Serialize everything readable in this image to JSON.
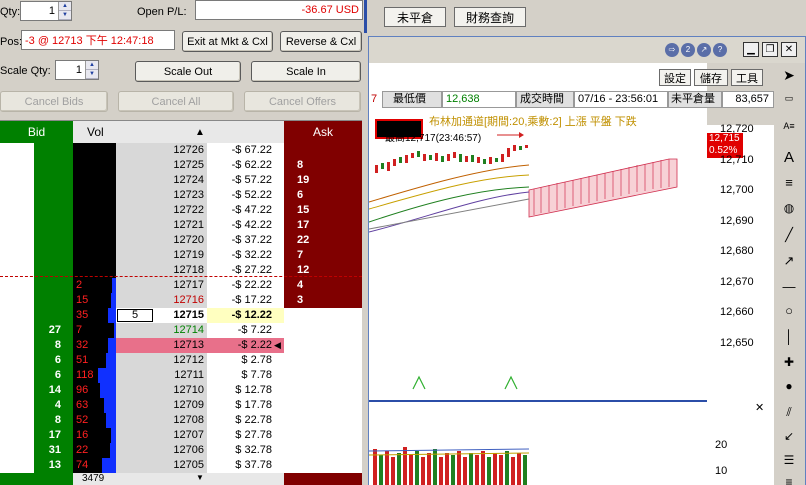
{
  "order_panel": {
    "qty_label": "Qty:",
    "qty_value": "1",
    "open_pl_label": "Open P/L:",
    "open_pl_value": "-36.67 USD",
    "pos_label": "Pos:",
    "pos_value": "-3 @ 12713 下午 12:47:18",
    "close_mkt_button": "Exit at Mkt & Cxl",
    "reverse_button": "Reverse & Cxl",
    "scale_qty_label": "Scale Qty:",
    "scale_qty_value": "1",
    "scale_out_button": "Scale Out",
    "scale_in_button": "Scale In",
    "cancel_bids_button": "Cancel Bids",
    "cancel_all_button": "Cancel All",
    "cancel_offers_button": "Cancel Offers"
  },
  "ladder": {
    "headers": {
      "bid": "Bid",
      "vol": "Vol",
      "ask": "Ask",
      "up_arrow": "▲",
      "down_arrow": "▼"
    },
    "rows": [
      {
        "bid": "",
        "vol": "",
        "price": "12726",
        "pl": "-$ 67.22",
        "ask": ""
      },
      {
        "bid": "",
        "vol": "",
        "price": "12725",
        "pl": "-$ 62.22",
        "ask": "8"
      },
      {
        "bid": "",
        "vol": "",
        "price": "12724",
        "pl": "-$ 57.22",
        "ask": "19"
      },
      {
        "bid": "",
        "vol": "",
        "price": "12723",
        "pl": "-$ 52.22",
        "ask": "6"
      },
      {
        "bid": "",
        "vol": "",
        "price": "12722",
        "pl": "-$ 47.22",
        "ask": "15"
      },
      {
        "bid": "",
        "vol": "",
        "price": "12721",
        "pl": "-$ 42.22",
        "ask": "17"
      },
      {
        "bid": "",
        "vol": "",
        "price": "12720",
        "pl": "-$ 37.22",
        "ask": "22"
      },
      {
        "bid": "",
        "vol": "",
        "price": "12719",
        "pl": "-$ 32.22",
        "ask": "7"
      },
      {
        "bid": "",
        "vol": "",
        "price": "12718",
        "pl": "-$ 27.22",
        "ask": "12"
      },
      {
        "bid": "",
        "vol": "2",
        "price": "12717",
        "pl": "-$ 22.22",
        "ask": "4"
      },
      {
        "bid": "",
        "vol": "15",
        "price": "12716",
        "pl": "-$ 17.22",
        "ask": "3"
      },
      {
        "bid": "",
        "vol": "35",
        "price": "12715",
        "pl": "-$ 12.22",
        "ask": ""
      },
      {
        "bid": "27",
        "vol": "7",
        "price": "12714",
        "pl": "-$ 7.22",
        "ask": ""
      },
      {
        "bid": "8",
        "vol": "32",
        "price": "12713",
        "pl": "-$ 2.22",
        "ask": ""
      },
      {
        "bid": "6",
        "vol": "51",
        "price": "12712",
        "pl": "$ 2.78",
        "ask": ""
      },
      {
        "bid": "6",
        "vol": "118",
        "price": "12711",
        "pl": "$ 7.78",
        "ask": ""
      },
      {
        "bid": "14",
        "vol": "96",
        "price": "12710",
        "pl": "$ 12.78",
        "ask": ""
      },
      {
        "bid": "4",
        "vol": "63",
        "price": "12709",
        "pl": "$ 17.78",
        "ask": ""
      },
      {
        "bid": "8",
        "vol": "52",
        "price": "12708",
        "pl": "$ 22.78",
        "ask": ""
      },
      {
        "bid": "17",
        "vol": "16",
        "price": "12707",
        "pl": "$ 27.78",
        "ask": ""
      },
      {
        "bid": "31",
        "vol": "22",
        "price": "12706",
        "pl": "$ 32.78",
        "ask": ""
      },
      {
        "bid": "13",
        "vol": "74",
        "price": "12705",
        "pl": "$ 37.78",
        "ask": ""
      }
    ],
    "order_qty": "5",
    "total_vol": "3479"
  },
  "toolbar_right": {
    "unclosed_button": "未平倉",
    "finance_button": "財務查詢"
  },
  "chart_window": {
    "settings_button": "設定",
    "save_button": "儲存",
    "tools_button": "工具",
    "low_label": "最低價",
    "low_value": "12,638",
    "time_label": "成交時間",
    "time_value": "07/16 - 23:56:01",
    "oi_label": "未平倉量",
    "oi_value": "83,657",
    "left_cut_value": "7",
    "indicator_text": "布林加通道[期間:20,乘數:2] 上漲  平盤  下跌",
    "high_annotation": "最高12,717(23:46:57)",
    "last_price_tag": "12,715",
    "last_pct_tag": "0.52%"
  },
  "price_axis": [
    "12,720",
    "12,710",
    "12,700",
    "12,690",
    "12,680",
    "12,670",
    "12,660",
    "12,650"
  ],
  "volume_axis": [
    "20",
    "10"
  ],
  "colors": {
    "bid_green": "#008000",
    "ask_maroon": "#800000",
    "vol_red": "#ff2020",
    "pl_red": "#e00000",
    "current_price_pink": "#e8708a",
    "accent_blue": "#2b4ea8"
  }
}
